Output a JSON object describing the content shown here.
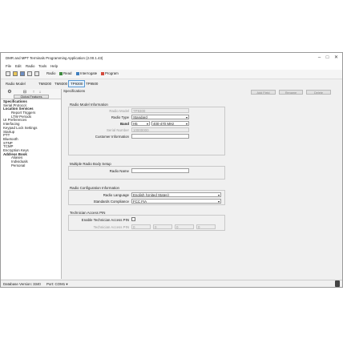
{
  "app": {
    "title": "DMR and MPT Terminals Programming Application (2.00.1.43)"
  },
  "window_controls": {
    "minimize": "–",
    "maximize": "□",
    "close": "✕"
  },
  "menu": [
    "File",
    "Edit",
    "Radio",
    "Tools",
    "Help"
  ],
  "toolbar": {
    "icons": [
      "new-file-icon",
      "open-folder-icon",
      "save-icon",
      "print-icon",
      "copy-icon"
    ],
    "radio_label": "Radio",
    "read_label": "Read",
    "interrogate_label": "Interrogate",
    "program_label": "Program"
  },
  "model_bar": {
    "label": "Radio Model",
    "tabs": [
      "TM8200",
      "TM9300",
      "TP9300",
      "TP9500"
    ],
    "active_tab": "TP9300"
  },
  "sidebar": {
    "header_icons": [
      "gear-icon",
      "filter-icon",
      "up-arrow-icon",
      "down-arrow-icon"
    ],
    "global_features": "Global Features",
    "tree": [
      {
        "label": "Specifications",
        "level": 0,
        "bold": true
      },
      {
        "label": "Serial Protocol",
        "level": 0,
        "bold": false
      },
      {
        "label": "Location Services",
        "level": 0,
        "bold": true
      },
      {
        "label": "Report Triggers",
        "level": 1,
        "bold": false
      },
      {
        "label": "LTW Periods",
        "level": 1,
        "bold": false
      },
      {
        "label": "UI Preferences",
        "level": 0,
        "bold": false
      },
      {
        "label": "Interfacing",
        "level": 0,
        "bold": false
      },
      {
        "label": "Keypad Lock Settings",
        "level": 0,
        "bold": false
      },
      {
        "label": "Startup",
        "level": 0,
        "bold": false
      },
      {
        "label": "PTT",
        "level": 0,
        "bold": false
      },
      {
        "label": "Bluetooth",
        "level": 0,
        "bold": false
      },
      {
        "label": "STNP",
        "level": 0,
        "bold": false
      },
      {
        "label": "TCMP",
        "level": 0,
        "bold": false
      },
      {
        "label": "Encryption Keys",
        "level": 0,
        "bold": false
      },
      {
        "label": "Address Book",
        "level": 0,
        "bold": true
      },
      {
        "label": "Aliases",
        "level": 1,
        "bold": false
      },
      {
        "label": "Individuals",
        "level": 1,
        "bold": false
      },
      {
        "label": "Personal",
        "level": 1,
        "bold": false
      }
    ]
  },
  "panel": {
    "title": "Specifications",
    "buttons": {
      "add": "Add Field",
      "rename": "Rename",
      "delete": "Delete"
    },
    "model_info": {
      "title": "Radio Model Information",
      "radio_model_label": "Radio Model",
      "radio_model_value": "TP9300",
      "radio_type_label": "Radio Type",
      "radio_type_value": "Standard",
      "band_label": "Band",
      "band_value": "H5",
      "band_range_value": "400-470 MHz",
      "serial_label": "Serial Number",
      "serial_value": "10000000",
      "customer_info_label": "Customer Information",
      "customer_info_value": ""
    },
    "body_setup": {
      "title": "Multiple Radio Body Setup",
      "radio_name_label": "Radio Name",
      "radio_name_value": ""
    },
    "config": {
      "title": "Radio Configuration Information",
      "language_label": "Radio Language",
      "language_value": "English (United States)",
      "compliance_label": "Standards Compliance",
      "compliance_value": "FCC FIA"
    },
    "tech_pin": {
      "title": "Technician Access PIN",
      "enable_label": "Enable Technician Access PIN",
      "pin_label": "Technician Access PIN",
      "pin_fields": [
        "0",
        "0",
        "0",
        "0"
      ]
    }
  },
  "statusbar": {
    "db_label": "Database Version: 3340",
    "port_label": "Port: COM1 ▾"
  }
}
